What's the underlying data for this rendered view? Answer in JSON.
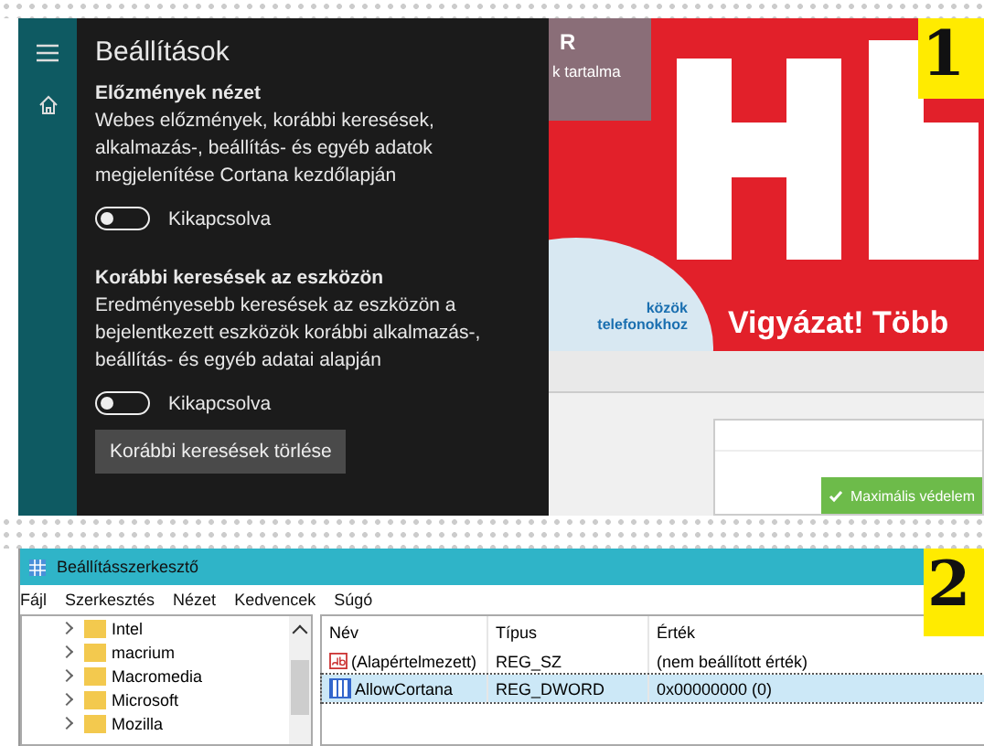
{
  "settings_panel": {
    "title": "Beállítások",
    "sections": [
      {
        "heading": "Előzmények nézet",
        "description": "Webes előzmények, korábbi keresések, alkalmazás-, beállítás- és egyéb adatok megjelenítése Cortana kezdőlapján",
        "toggle": {
          "on": false,
          "label": "Kikapcsolva"
        }
      },
      {
        "heading": "Korábbi keresések az eszközön",
        "description": "Eredményesebb keresések az eszközön a bejelentkezett eszközök korábbi alkalmazás-, beállítás- és egyéb adatai alapján",
        "toggle": {
          "on": false,
          "label": "Kikapcsolva"
        },
        "button": "Korábbi keresések törlése"
      }
    ]
  },
  "background_page": {
    "header_letter": "R",
    "header_link": "k tartalma",
    "disc_text": [
      "közök",
      "telefonokhoz"
    ],
    "banner": "Vigyázat! Több",
    "app_window": {
      "status": "Maximális védelem"
    }
  },
  "step_badges": [
    "1",
    "2"
  ],
  "registry_editor": {
    "title": "Beállításszerkesztő",
    "menu": [
      "Fájl",
      "Szerkesztés",
      "Nézet",
      "Kedvencek",
      "Súgó"
    ],
    "tree": [
      {
        "label": "Intel",
        "expanded": false
      },
      {
        "label": "macrium",
        "expanded": false
      },
      {
        "label": "Macromedia",
        "expanded": false
      },
      {
        "label": "Microsoft",
        "expanded": false
      },
      {
        "label": "Mozilla",
        "expanded": false
      }
    ],
    "columns": [
      "Név",
      "Típus",
      "Érték"
    ],
    "rows": [
      {
        "kind": "string",
        "name": "(Alapértelmezett)",
        "type": "REG_SZ",
        "value": "(nem beállított érték)",
        "selected": false
      },
      {
        "kind": "dword",
        "name": "AllowCortana",
        "type": "REG_DWORD",
        "value": "0x00000000 (0)",
        "selected": true
      }
    ]
  }
}
